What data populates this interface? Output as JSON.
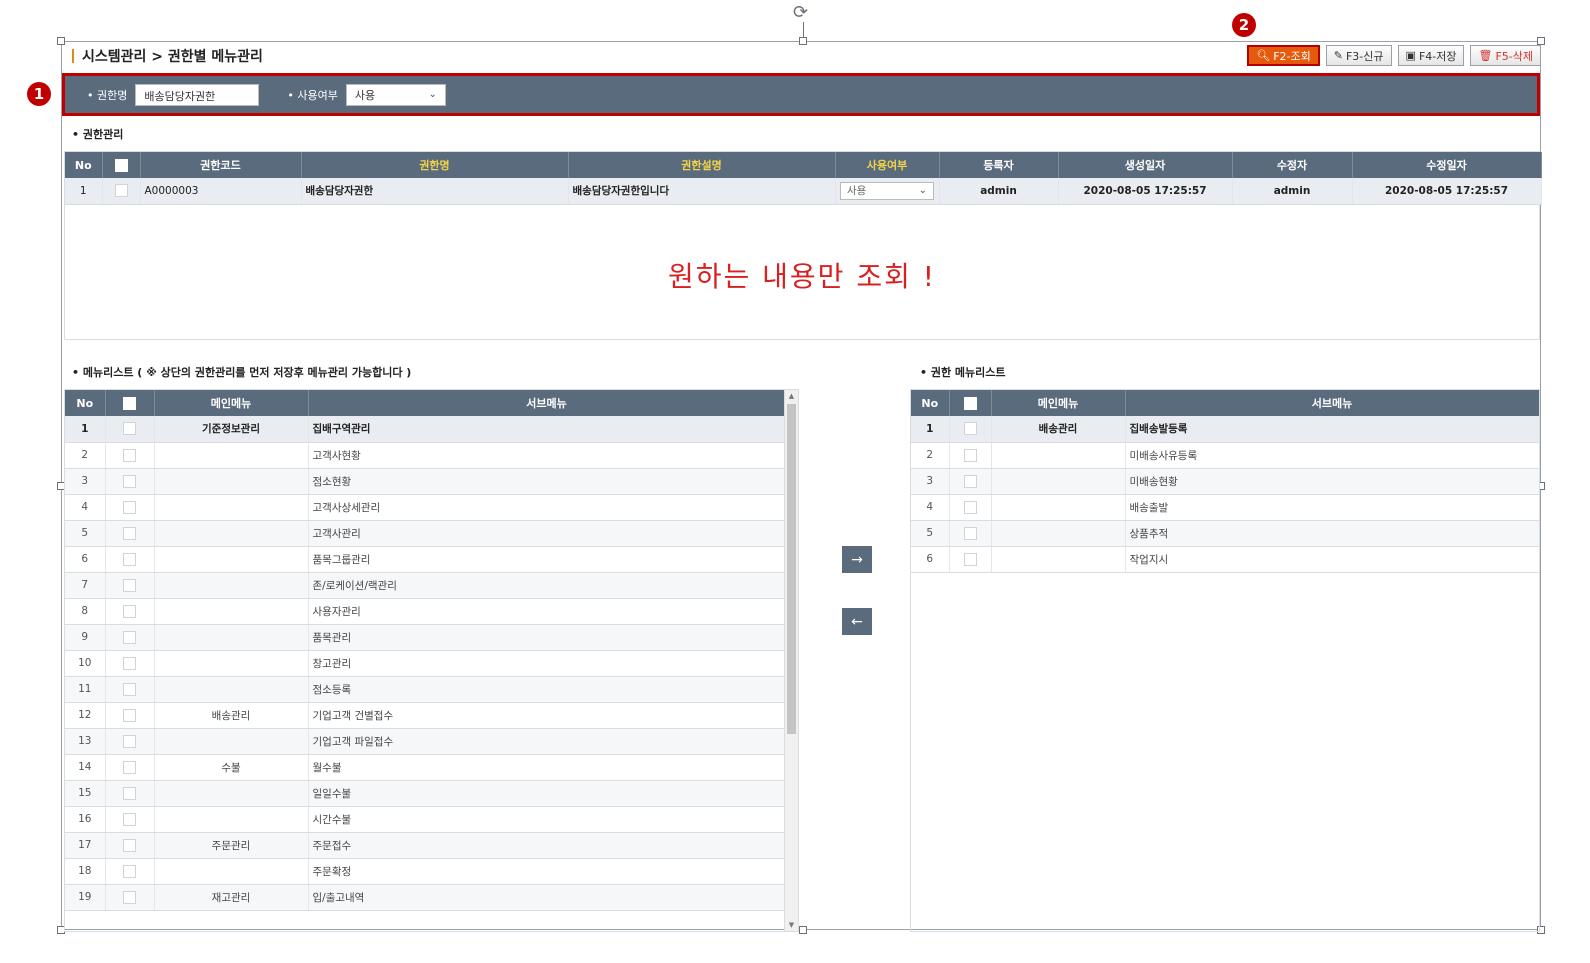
{
  "breadcrumb": "시스템관리 > 권한별 메뉴관리",
  "markers": {
    "one": "1",
    "two": "2"
  },
  "toolbar": {
    "search_label": "F2-조회",
    "new_label": "F3-신규",
    "save_label": "F4-저장",
    "delete_label": "F5-삭제"
  },
  "filters": {
    "auth_name_label": "• 권한명",
    "auth_name_value": "배송담당자권한",
    "use_label": "• 사용여부",
    "use_value": "사용"
  },
  "auth_section": {
    "title": "• 권한관리",
    "columns": [
      "No",
      "",
      "권한코드",
      "권한명",
      "권한설명",
      "사용여부",
      "등록자",
      "생성일자",
      "수정자",
      "수정일자"
    ],
    "rows": [
      {
        "no": "1",
        "code": "A0000003",
        "name": "배송담당자권한",
        "desc": "배송담당자권한입니다",
        "use": "사용",
        "reg_user": "admin",
        "created": "2020-08-05 17:25:57",
        "mod_user": "admin",
        "modified": "2020-08-05 17:25:57"
      }
    ],
    "message": "원하는 내용만 조회 !"
  },
  "menu_list": {
    "title": "• 메뉴리스트 ( ※ 상단의 권한관리를 먼저 저장후 메뉴관리 가능합니다 )",
    "columns": [
      "No",
      "",
      "메인메뉴",
      "서브메뉴"
    ],
    "rows": [
      {
        "no": "1",
        "main": "기준정보관리",
        "sub": "집배구역관리"
      },
      {
        "no": "2",
        "main": "",
        "sub": "고객사현황"
      },
      {
        "no": "3",
        "main": "",
        "sub": "점소현황"
      },
      {
        "no": "4",
        "main": "",
        "sub": "고객사상세관리"
      },
      {
        "no": "5",
        "main": "",
        "sub": "고객사관리"
      },
      {
        "no": "6",
        "main": "",
        "sub": "품목그룹관리"
      },
      {
        "no": "7",
        "main": "",
        "sub": "존/로케이션/랙관리"
      },
      {
        "no": "8",
        "main": "",
        "sub": "사용자관리"
      },
      {
        "no": "9",
        "main": "",
        "sub": "품목관리"
      },
      {
        "no": "10",
        "main": "",
        "sub": "창고관리"
      },
      {
        "no": "11",
        "main": "",
        "sub": "점소등록"
      },
      {
        "no": "12",
        "main": "배송관리",
        "sub": "기업고객 건별접수"
      },
      {
        "no": "13",
        "main": "",
        "sub": "기업고객 파일접수"
      },
      {
        "no": "14",
        "main": "수불",
        "sub": "월수불"
      },
      {
        "no": "15",
        "main": "",
        "sub": "일일수불"
      },
      {
        "no": "16",
        "main": "",
        "sub": "시간수불"
      },
      {
        "no": "17",
        "main": "주문관리",
        "sub": "주문접수"
      },
      {
        "no": "18",
        "main": "",
        "sub": "주문확정"
      },
      {
        "no": "19",
        "main": "재고관리",
        "sub": "입/출고내역"
      }
    ]
  },
  "auth_menu_list": {
    "title": "• 권한 메뉴리스트",
    "columns": [
      "No",
      "",
      "메인메뉴",
      "서브메뉴"
    ],
    "rows": [
      {
        "no": "1",
        "main": "배송관리",
        "sub": "집배송발등록"
      },
      {
        "no": "2",
        "main": "",
        "sub": "미배송사유등록"
      },
      {
        "no": "3",
        "main": "",
        "sub": "미배송현황"
      },
      {
        "no": "4",
        "main": "",
        "sub": "배송출발"
      },
      {
        "no": "5",
        "main": "",
        "sub": "상품추적"
      },
      {
        "no": "6",
        "main": "",
        "sub": "작업지시"
      }
    ]
  },
  "move_buttons": {
    "right_icon": "arrow-right-icon",
    "left_icon": "arrow-left-icon"
  },
  "colors": {
    "header_bg": "#5a6b7d",
    "highlight": "#c00000",
    "search_btn": "#e55a0d",
    "yellow_header": "#f2d34a"
  }
}
